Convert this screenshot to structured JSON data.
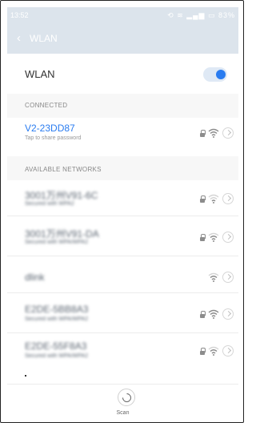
{
  "status_bar": {
    "time": "13:52",
    "icons_text": "⟲ ≋ ▂▄▆ ▭ 83%"
  },
  "app_bar": {
    "back_glyph": "‹",
    "title": "WLAN"
  },
  "wlan_row": {
    "label": "WLAN",
    "toggle_on": true
  },
  "connected": {
    "section_label": "CONNECTED",
    "network": {
      "name": "V2-23DD87",
      "subtitle": "Tap to share password",
      "secured": true
    }
  },
  "available": {
    "section_label": "AVAILABLE NETWORKS",
    "networks": [
      {
        "name": "3001万州V91-6C",
        "subtitle": "Secured with WPA2",
        "secured": true
      },
      {
        "name": "3001万州V91-DA",
        "subtitle": "Secured with WPA/WPA2",
        "secured": true
      },
      {
        "name": "dlink",
        "subtitle": "",
        "secured": false
      },
      {
        "name": "E2DE-5BB8A3",
        "subtitle": "Secured with WPA/WPA2",
        "secured": true
      },
      {
        "name": "E2DE-55F8A3",
        "subtitle": "Secured with WPA/WPA2",
        "secured": true
      }
    ]
  },
  "scan": {
    "label": "Scan"
  },
  "colors": {
    "accent": "#2a7cf0",
    "header": "#dce4ec"
  }
}
